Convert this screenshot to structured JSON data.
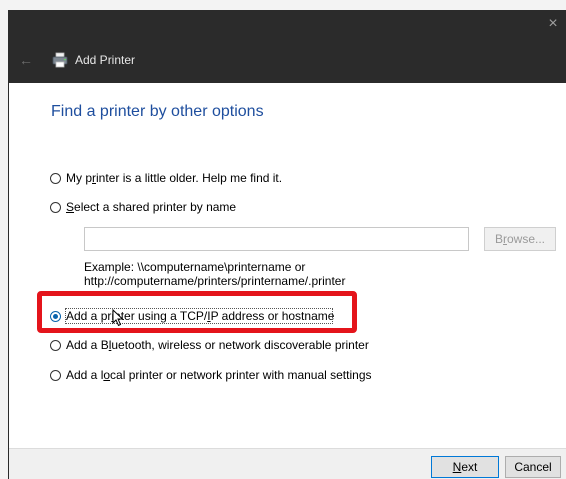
{
  "window": {
    "title": "Add Printer",
    "close_glyph": "×",
    "back_glyph": "←"
  },
  "page": {
    "heading": "Find a printer by other options"
  },
  "options": {
    "older": {
      "pre": "My p",
      "key": "r",
      "post": "inter is a little older. Help me find it.",
      "checked": false
    },
    "shared": {
      "pre": "",
      "key": "S",
      "post": "elect a shared printer by name",
      "checked": false
    },
    "tcpip": {
      "pre": "Add a pr",
      "key": "i",
      "mid": "nter using a TCP/",
      "key2": "I",
      "post": "P address or hostname",
      "checked": true
    },
    "bluetooth": {
      "pre": "Add a B",
      "key": "l",
      "post": "uetooth, wireless or network discoverable printer",
      "checked": false
    },
    "local": {
      "pre": "Add a l",
      "key": "o",
      "post": "cal printer or network printer with manual settings",
      "checked": false
    }
  },
  "shared_input": {
    "value": "",
    "placeholder": ""
  },
  "browse": {
    "pre": "B",
    "key": "r",
    "post": "owse..."
  },
  "example": {
    "line1": "Example: \\\\computername\\printername or",
    "line2": "http://computername/printers/printername/.printer"
  },
  "footer": {
    "next": {
      "key": "N",
      "post": "ext"
    },
    "cancel_label": "Cancel"
  },
  "colors": {
    "heading": "#1e4e9e",
    "highlight": "#e4141b",
    "titlebar": "#2b2b2b",
    "accent": "#0a64ad"
  },
  "icons": {
    "title": "printer-icon",
    "back": "back-arrow-icon",
    "close": "close-icon",
    "cursor": "mouse-cursor-icon"
  }
}
